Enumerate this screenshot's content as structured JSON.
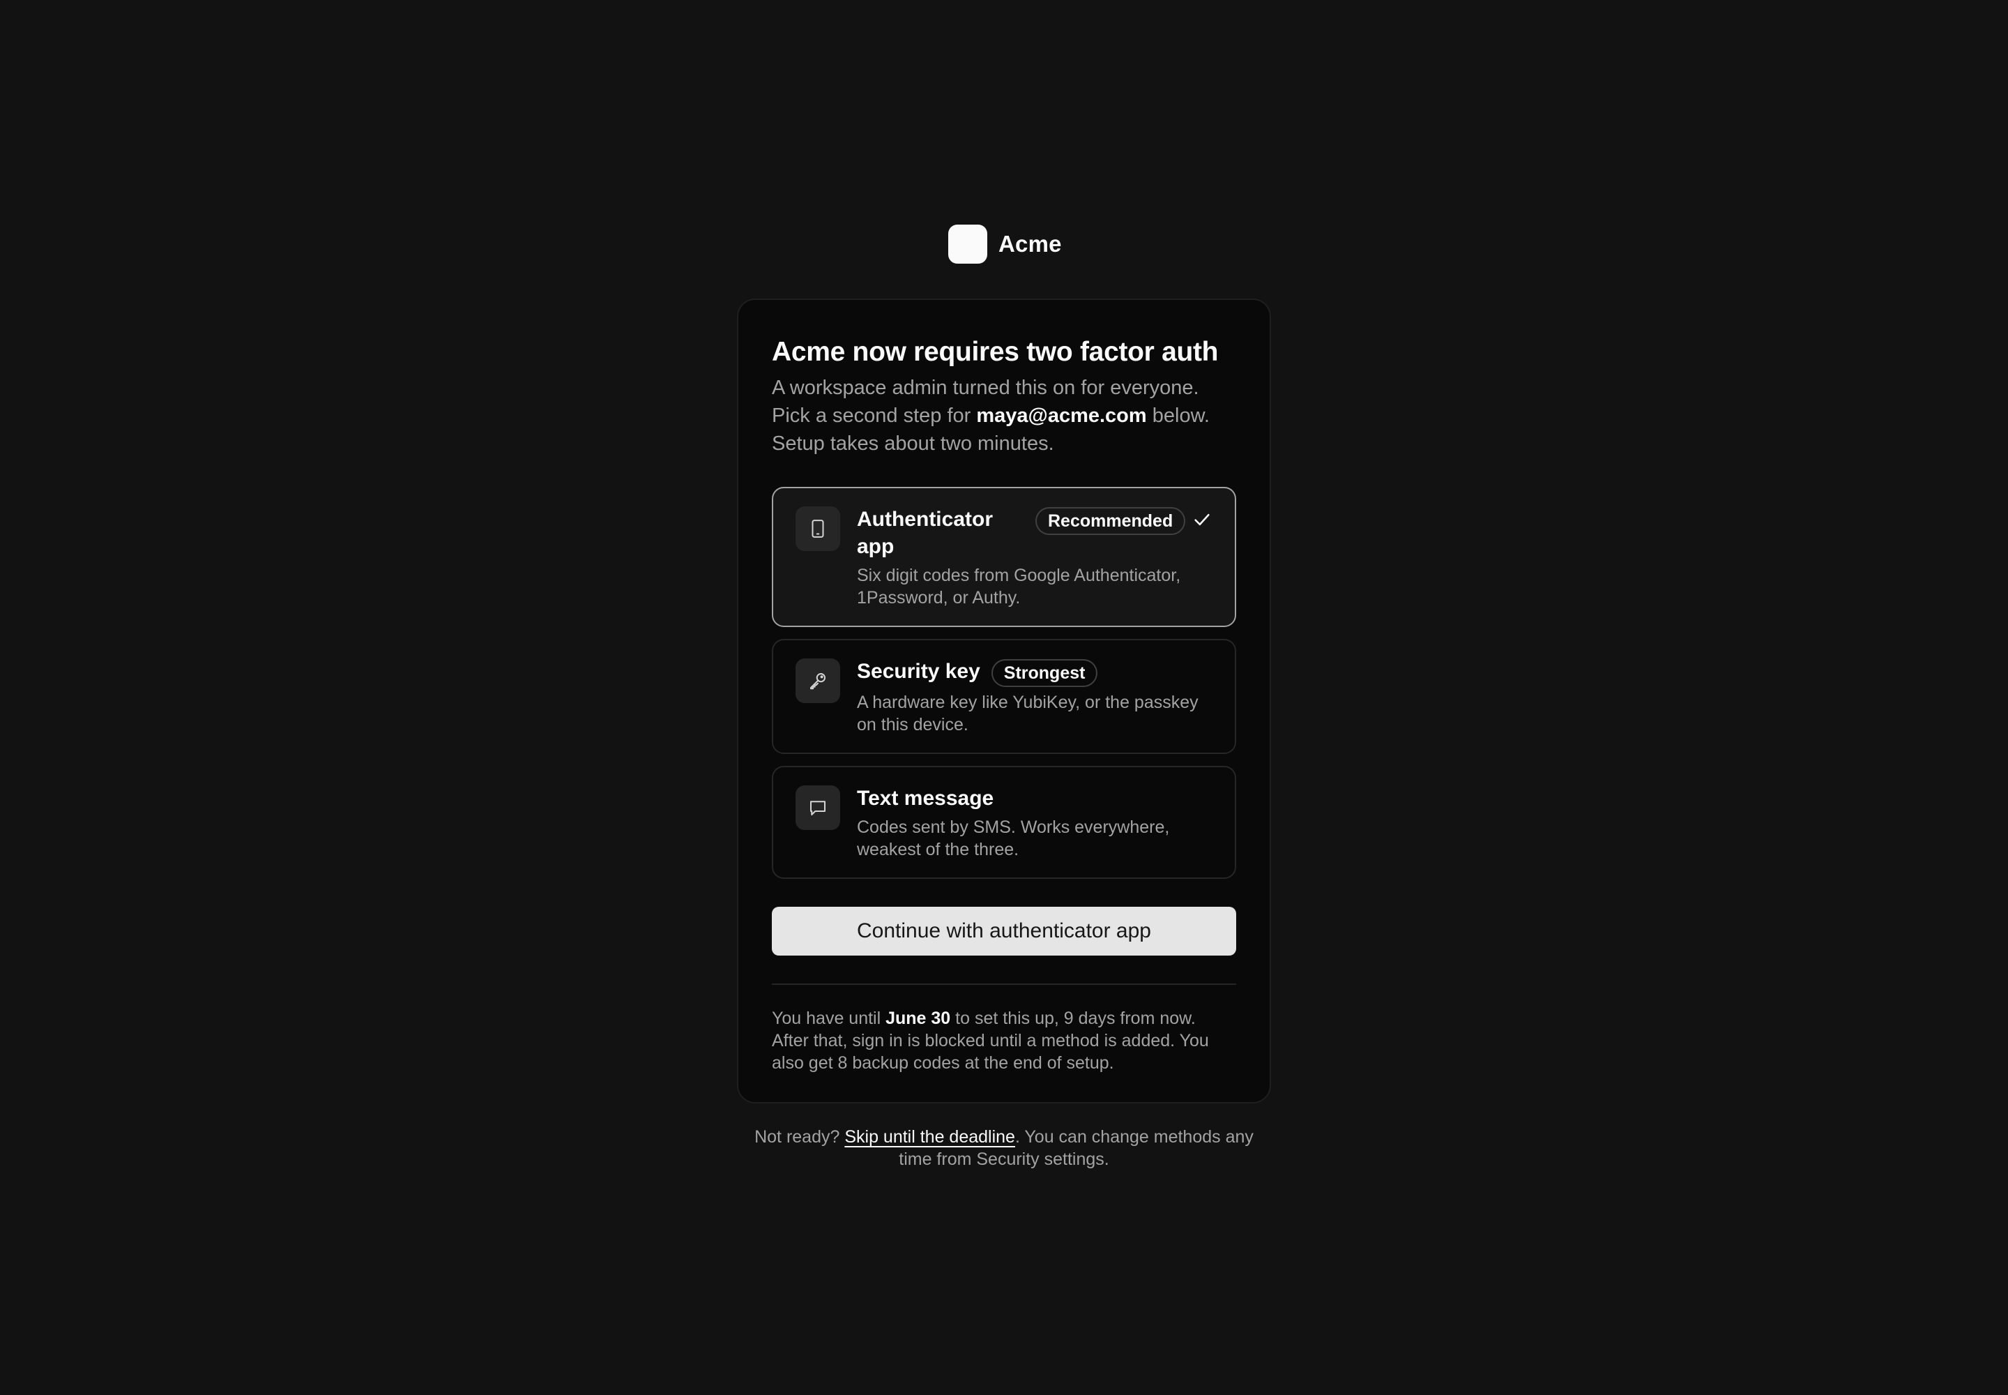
{
  "brand": {
    "name": "Acme"
  },
  "card": {
    "title": "Acme now requires two factor auth",
    "desc_part1": "A workspace admin turned this on for everyone. Pick a second step for ",
    "email": "maya@acme.com",
    "desc_part2": " below. Setup takes about two minutes."
  },
  "options": [
    {
      "icon": "phone-icon",
      "title": "Authenticator app",
      "badge": "Recommended",
      "desc": "Six digit codes from Google Authenticator, 1Password, or Authy.",
      "selected": true
    },
    {
      "icon": "key-icon",
      "title": "Security key",
      "badge": "Strongest",
      "desc": "A hardware key like YubiKey, or the passkey on this device.",
      "selected": false
    },
    {
      "icon": "message-icon",
      "title": "Text message",
      "badge": "",
      "desc": "Codes sent by SMS. Works everywhere, weakest of the three.",
      "selected": false
    }
  ],
  "cta": {
    "label": "Continue with authenticator app"
  },
  "deadline": {
    "part1": "You have until ",
    "date": "June 30",
    "part2": " to set this up, 9 days from now. After that, sign in is blocked until a method is added. You also get 8 backup codes at the end of setup."
  },
  "footnote": {
    "prefix": "Not ready? ",
    "link": "Skip until the deadline",
    "suffix": ". You can change methods any time from Security settings."
  },
  "colors": {
    "background": "#121212",
    "card": "#090909",
    "accent": "#fafafa",
    "muted": "#a3a3a3"
  }
}
